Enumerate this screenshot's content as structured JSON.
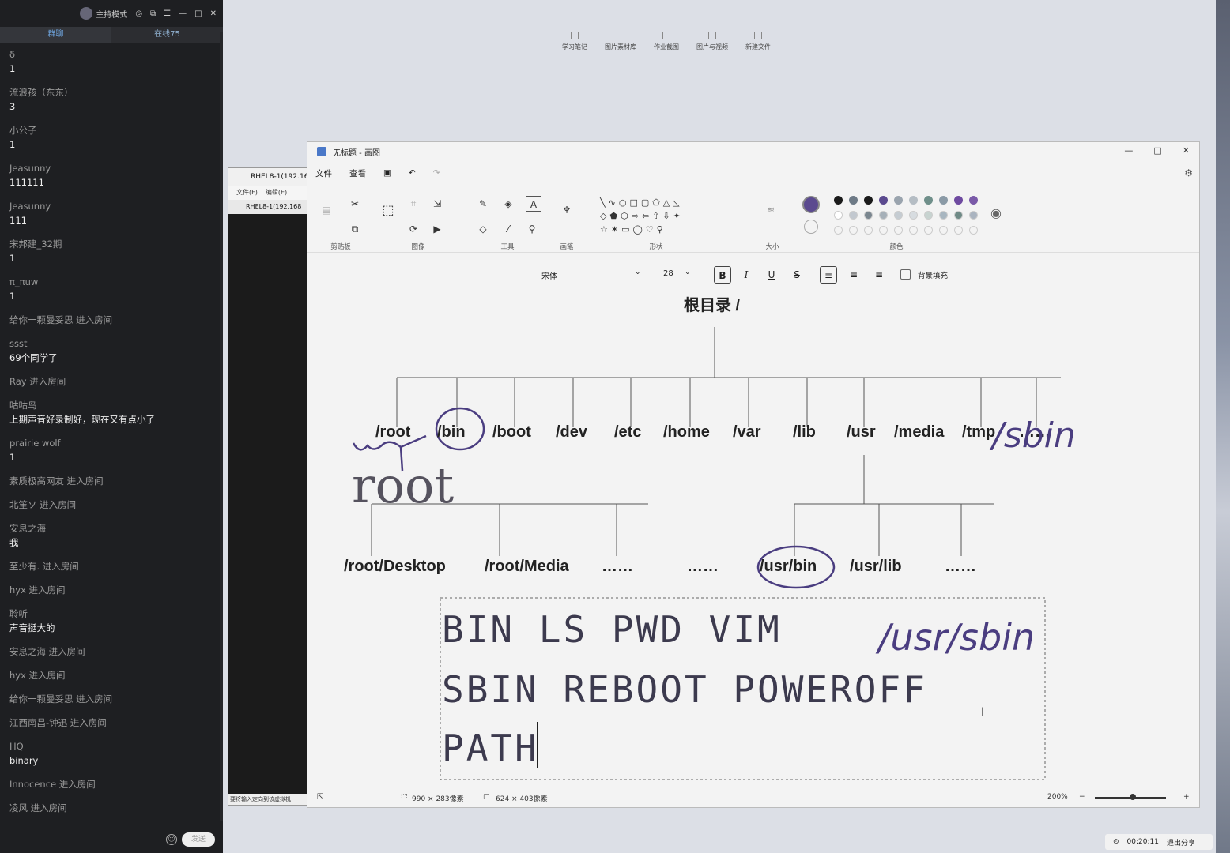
{
  "chat": {
    "host_mode": "主持模式",
    "tabs": [
      "群聊",
      "在线75"
    ],
    "messages": [
      {
        "name": "δ",
        "text": "1"
      },
      {
        "name": "流浪孩（东东）",
        "text": "3"
      },
      {
        "name": "小公子",
        "text": "1"
      },
      {
        "name": "Jeasunny",
        "text": "111111"
      },
      {
        "name": "Jeasunny",
        "text": "111"
      },
      {
        "name": "宋邦建_32期",
        "text": "1"
      },
      {
        "name": "π_πuw",
        "text": "1"
      },
      {
        "name": "给你一颗曼妥思 进入房间",
        "text": ""
      },
      {
        "name": "ssst",
        "text": "69个同学了"
      },
      {
        "name": "Ray 进入房间",
        "text": ""
      },
      {
        "name": "咕咕鸟",
        "text": "上期声音好录制好，现在又有点小了"
      },
      {
        "name": "prairie wolf",
        "text": "1"
      },
      {
        "name": "素质极高网友 进入房间",
        "text": ""
      },
      {
        "name": "北笙ソ 进入房间",
        "text": ""
      },
      {
        "name": "安息之海",
        "text": "我"
      },
      {
        "name": "至少有. 进入房间",
        "text": ""
      },
      {
        "name": "hyx 进入房间",
        "text": ""
      },
      {
        "name": "聆听",
        "text": "声音挺大的"
      },
      {
        "name": "安息之海 进入房间",
        "text": ""
      },
      {
        "name": "hyx 进入房间",
        "text": ""
      },
      {
        "name": "给你一颗曼妥思 进入房间",
        "text": ""
      },
      {
        "name": "江西南昌-钟迅 进入房间",
        "text": ""
      },
      {
        "name": "HQ",
        "text": "binary"
      },
      {
        "name": "Innocence 进入房间",
        "text": ""
      },
      {
        "name": "凌风 进入房间",
        "text": ""
      }
    ],
    "send_label": "发送"
  },
  "desktop_icons": [
    "学习笔记",
    "图片素材库",
    "作业截图",
    "图片与视频",
    "新建文件"
  ],
  "vm": {
    "title": "RHEL8-1(192.16",
    "menu": [
      "文件(F)",
      "编辑(E)"
    ],
    "tab": "RHEL8-1(192.168",
    "status": "要将输入定向到该虚拟机"
  },
  "paint": {
    "title": "无标题 - 画图",
    "menu": [
      "文件",
      "查看"
    ],
    "groups": [
      "剪贴板",
      "图像",
      "工具",
      "画笔",
      "形状",
      "大小",
      "颜色"
    ],
    "font_name": "宋体",
    "font_size": "28",
    "fill_label": "背景填充",
    "status_size": "990 × 283像素",
    "status_canvas": "624 × 403像素",
    "zoom": "200%",
    "colors_row1": [
      "#1a1a1a",
      "#6d7a86",
      "#1a1a1a",
      "#5b4a8f",
      "#9aa4ae",
      "#b5bdc4",
      "#6f8f8a",
      "#8a9aa6",
      "#6e4aa0",
      "#7a5aa8"
    ],
    "colors_row2": [
      "#ffffff",
      "#c2c8cf",
      "#7a868f",
      "#a6b0b8",
      "#c5ccd2",
      "#d7dce0",
      "#c7d3d0",
      "#a8b6c0",
      "#6f8a86",
      "#aab4c0"
    ],
    "selected_color": "#5b4a8f"
  },
  "diagram": {
    "root": "根目录 /",
    "level1": [
      "/root",
      "/bin",
      "/boot",
      "/dev",
      "/etc",
      "/home",
      "/var",
      "/lib",
      "/usr",
      "/media",
      "/tmp",
      "……"
    ],
    "level2_left": [
      "/root/Desktop",
      "/root/Media",
      "……"
    ],
    "level2_mid": "……",
    "level2_right": [
      "/usr/bin",
      "/usr/lib",
      "……"
    ],
    "handwriting": {
      "root": "root",
      "sbin": "/sbin",
      "usr_sbin": "/usr/sbin"
    },
    "typed_lines": [
      "BIN LS PWD VIM",
      "SBIN REBOOT POWEROFF",
      "PATH"
    ]
  },
  "share": {
    "timer": "00:20:11",
    "exit": "退出分享"
  }
}
